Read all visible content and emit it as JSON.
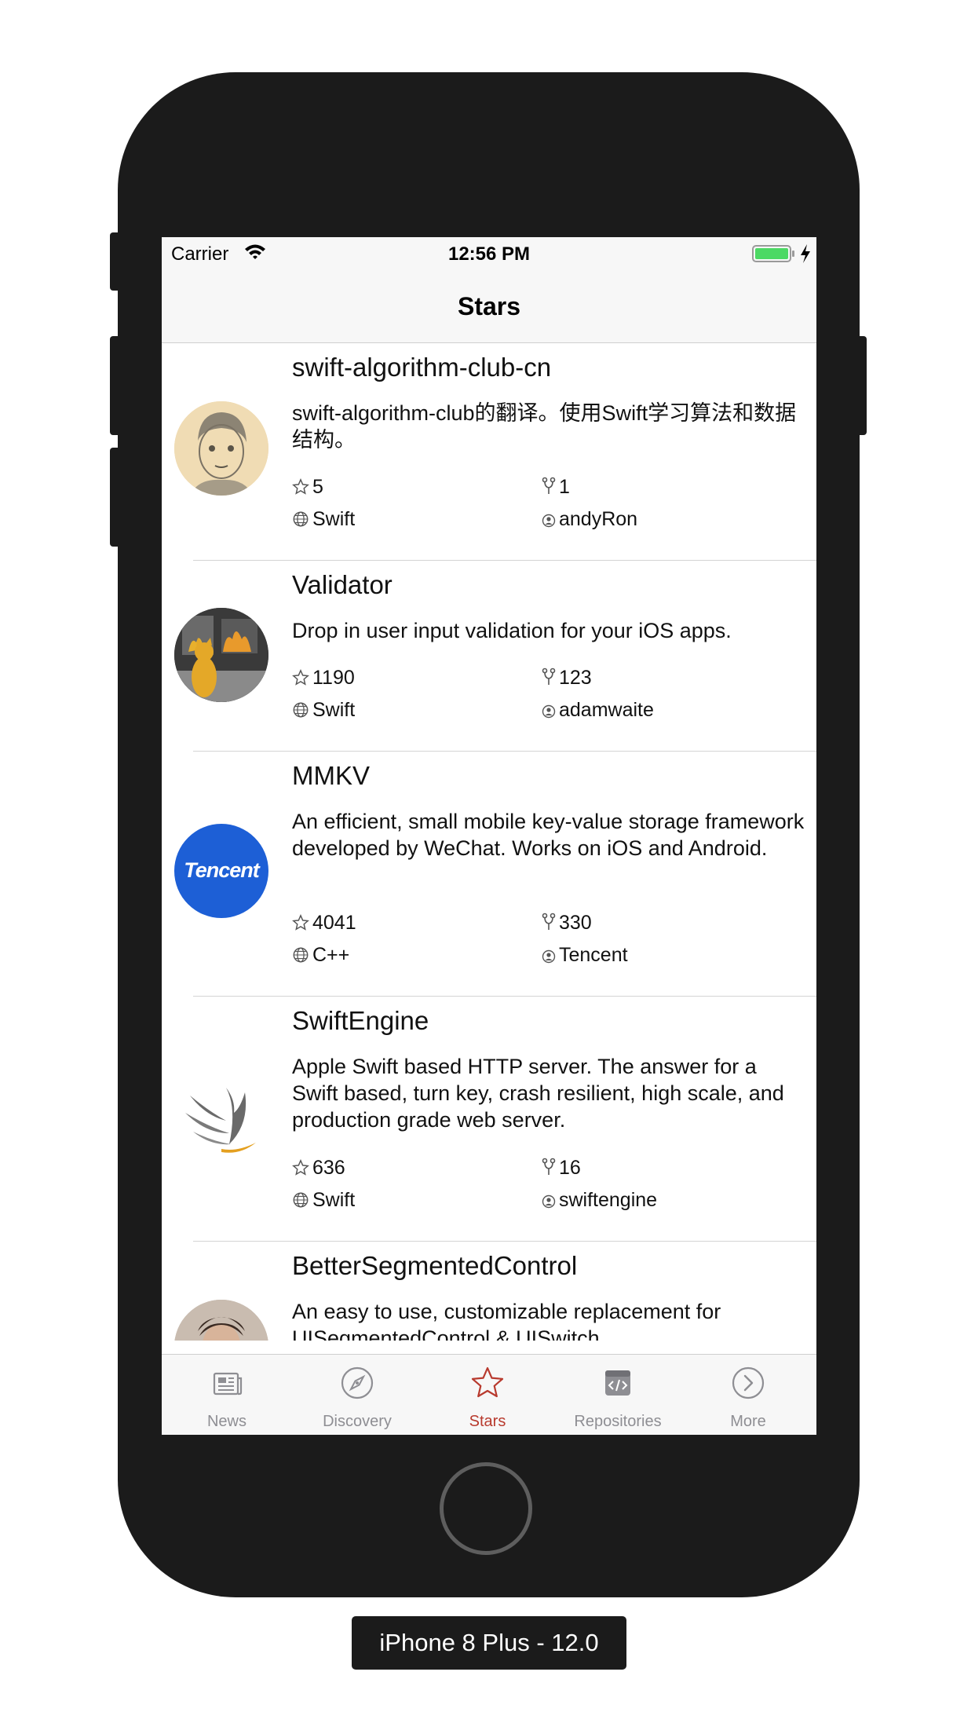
{
  "device_label": "iPhone 8 Plus - 12.0",
  "status_bar": {
    "carrier": "Carrier",
    "time": "12:56 PM"
  },
  "nav": {
    "title": "Stars"
  },
  "repos": [
    {
      "name": "swift-algorithm-club-cn",
      "description": "swift-algorithm-club的翻译。使用Swift学习算法和数据结构。",
      "stars": "5",
      "forks": "1",
      "language": "Swift",
      "owner": "andyRon",
      "avatar": "sketch-portrait-avatar"
    },
    {
      "name": "Validator",
      "description": "Drop in user input validation for your iOS apps.",
      "stars": "1190",
      "forks": "123",
      "language": "Swift",
      "owner": "adamwaite",
      "avatar": "cat-fire-avatar"
    },
    {
      "name": "MMKV",
      "description": "An efficient, small mobile key-value storage framework developed by WeChat. Works on iOS and Android.",
      "stars": "4041",
      "forks": "330",
      "language": "C++",
      "owner": "Tencent",
      "avatar": "tencent-logo-avatar",
      "avatar_logo_text": "Tencent"
    },
    {
      "name": "SwiftEngine",
      "description": "Apple Swift based HTTP server.  The answer for a Swift based, turn key, crash resilient, high scale, and production grade web server.",
      "stars": "636",
      "forks": "16",
      "language": "Swift",
      "owner": "swiftengine",
      "avatar": "swiftengine-wing-avatar"
    },
    {
      "name": "BetterSegmentedControl",
      "description": "An easy to use, customizable replacement for UISegmentedControl & UISwitch.",
      "avatar": "person-photo-avatar"
    }
  ],
  "tabs": [
    {
      "label": "News",
      "icon": "newspaper-icon"
    },
    {
      "label": "Discovery",
      "icon": "compass-icon"
    },
    {
      "label": "Stars",
      "icon": "star-icon"
    },
    {
      "label": "Repositories",
      "icon": "code-box-icon"
    },
    {
      "label": "More",
      "icon": "chevron-circle-icon"
    }
  ],
  "colors": {
    "accent": "#b83a2e",
    "tab_inactive": "#8e8e93",
    "tencent_blue": "#1d5fd6",
    "battery": "#4cd964"
  }
}
